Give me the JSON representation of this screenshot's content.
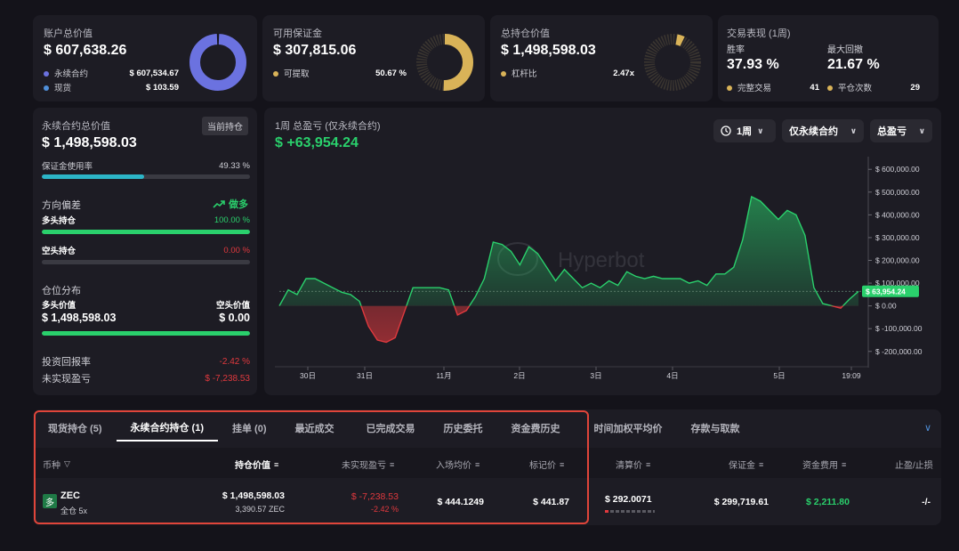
{
  "account": {
    "title": "账户总价值",
    "value": "$ 607,638.26",
    "items": [
      {
        "label": "永续合约",
        "value": "$ 607,534.67"
      },
      {
        "label": "现货",
        "value": "$ 103.59"
      }
    ],
    "colors": [
      "#6b72e0",
      "#4f8fd9"
    ]
  },
  "margin": {
    "title": "可用保证金",
    "value": "$ 307,815.06",
    "item_label": "可提取",
    "item_value": "50.67 %",
    "withdrawable_fraction": 0.5067,
    "color": "#d9b358"
  },
  "position_value": {
    "title": "总持仓价值",
    "value": "$ 1,498,598.03",
    "item_label": "杠杆比",
    "item_value": "2.47x",
    "color": "#d9b358"
  },
  "performance": {
    "title": "交易表现 (1周)",
    "win_rate_label": "胜率",
    "win_rate": "37.93 %",
    "drawdown_label": "最大回撤",
    "drawdown": "21.67 %",
    "completed_label": "完整交易",
    "completed": "41",
    "close_label": "平仓次数",
    "close": "29"
  },
  "perp_summary": {
    "title": "永续合约总价值",
    "badge": "当前持仓",
    "value": "$ 1,498,598.03",
    "margin_usage_label": "保证金使用率",
    "margin_usage": "49.33 %",
    "margin_usage_fraction": 0.4933,
    "bias_label": "方向偏差",
    "bias_value": "做多",
    "long_label": "多头持仓",
    "long_pct": "100.00 %",
    "long_fraction": 1.0,
    "short_label": "空头持仓",
    "short_pct": "0.00 %",
    "short_fraction": 0.0,
    "distribution_label": "仓位分布",
    "long_value_label": "多头价值",
    "long_value": "$ 1,498,598.03",
    "short_value_label": "空头价值",
    "short_value": "$ 0.00",
    "roi_label": "投资回报率",
    "roi": "-2.42 %",
    "unrealized_label": "未实现盈亏",
    "unrealized": "$ -7,238.53"
  },
  "pnl_chart": {
    "title": "1周 总盈亏 (仅永续合约)",
    "value": "$ +63,954.24",
    "filters": [
      "1周",
      "仅永续合约",
      "总盈亏"
    ],
    "watermark": "Hyperbot"
  },
  "chart_data": {
    "type": "area",
    "x_ticks": [
      "30日",
      "31日",
      "11月",
      "2日",
      "3日",
      "4日",
      "5日",
      "19:09"
    ],
    "y_ticks": [
      "$ 600,000.00",
      "$ 500,000.00",
      "$ 400,000.00",
      "$ 300,000.00",
      "$ 200,000.00",
      "$ 100,000.00",
      "$ 0.00",
      "$ -100,000.00",
      "$ -200,000.00"
    ],
    "ylim": [
      -240000,
      640000
    ],
    "current_label": "$ 63,954.24",
    "current_value": 63954.24,
    "colors": {
      "positive": "#2ad06c",
      "negative": "#e0393e"
    },
    "values": [
      0,
      70000,
      50000,
      120000,
      120000,
      100000,
      80000,
      60000,
      50000,
      20000,
      -90000,
      -150000,
      -160000,
      -140000,
      -30000,
      80000,
      80000,
      80000,
      80000,
      70000,
      -40000,
      -20000,
      40000,
      120000,
      280000,
      270000,
      240000,
      180000,
      260000,
      230000,
      170000,
      110000,
      160000,
      120000,
      80000,
      100000,
      80000,
      110000,
      90000,
      150000,
      130000,
      120000,
      130000,
      120000,
      120000,
      120000,
      100000,
      110000,
      90000,
      140000,
      140000,
      170000,
      290000,
      480000,
      460000,
      420000,
      380000,
      420000,
      400000,
      310000,
      80000,
      10000,
      0,
      -10000,
      30000,
      63954
    ]
  },
  "tabs": [
    "现货持仓 (5)",
    "永续合约持仓 (1)",
    "挂单 (0)",
    "最近成交",
    "已完成交易",
    "历史委托",
    "资金费历史",
    "时间加权平均价",
    "存款与取款"
  ],
  "table": {
    "headers": [
      "币种",
      "持仓价值",
      "未实现盈亏",
      "入场均价",
      "标记价",
      "清算价",
      "保证金",
      "资金费用",
      "止盈/止损"
    ],
    "row": {
      "side": "多",
      "coin": "ZEC",
      "mode": "全仓 5x",
      "position_value": "$ 1,498,598.03",
      "size": "3,390.57 ZEC",
      "pnl": "$ -7,238.53",
      "pnl_pct": "-2.42 %",
      "entry": "$ 444.1249",
      "mark": "$ 441.87",
      "liq": "$ 292.0071",
      "margin": "$ 299,719.61",
      "funding": "$ 2,211.80",
      "tpsl": "-/-"
    }
  }
}
